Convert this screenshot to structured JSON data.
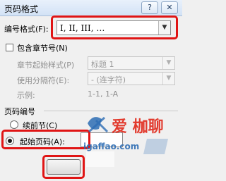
{
  "window": {
    "title": "页码格式",
    "help_glyph": "?",
    "close_glyph": "✕"
  },
  "number_format": {
    "label": "编号格式(F):",
    "value": "I, II, III, …"
  },
  "include_chapter": {
    "label": "包含章节号(N)",
    "checked": false
  },
  "chapter_style": {
    "label": "章节起始样式(P)",
    "value": "标题 1"
  },
  "separator": {
    "label": "使用分隔符(E):",
    "value": "- (连字符)"
  },
  "example": {
    "label": "示例:",
    "value": "1-1, 1-A"
  },
  "page_numbering": {
    "group_label": "页码编号",
    "continue_label": "续前节(C)",
    "start_at_label": "起始页码(A):",
    "start_at_value": "",
    "selected": "start_at"
  },
  "watermark": {
    "site": "igaffao.com",
    "logo": "爱 枷聊"
  },
  "colors": {
    "highlight": "#e01515",
    "titlebar": "#d2e2f6",
    "watermark": "#2d6db4"
  }
}
